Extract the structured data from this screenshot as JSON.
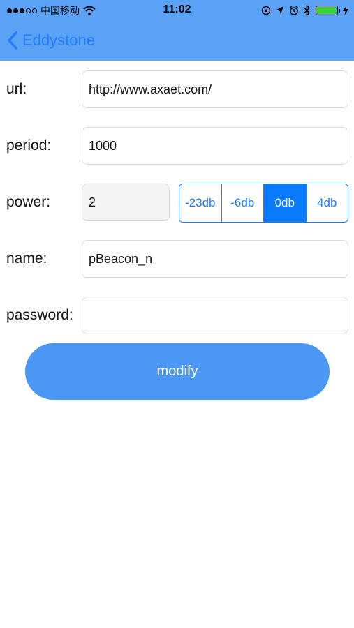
{
  "status_bar": {
    "carrier": "中国移动",
    "time": "11:02",
    "battery_level": 1.0,
    "battery_color": "#3ed23e"
  },
  "nav": {
    "back_label": "Eddystone",
    "back_icon": "chevron-left-icon"
  },
  "form": {
    "url": {
      "label": "url:",
      "value": "http://www.axaet.com/"
    },
    "period": {
      "label": "period:",
      "value": "1000"
    },
    "power": {
      "label": "power:",
      "value": "2",
      "options": [
        "-23db",
        "-6db",
        "0db",
        "4db"
      ],
      "selected": "0db"
    },
    "name": {
      "label": "name:",
      "value": "pBeacon_n"
    },
    "password": {
      "label": "password:",
      "value": ""
    }
  },
  "modify_button": {
    "label": "modify"
  },
  "colors": {
    "header_bg": "#5aa2f5",
    "accent": "#1f7cff",
    "segment_selected": "#0a7bff",
    "button_bg": "#4a98f4"
  }
}
